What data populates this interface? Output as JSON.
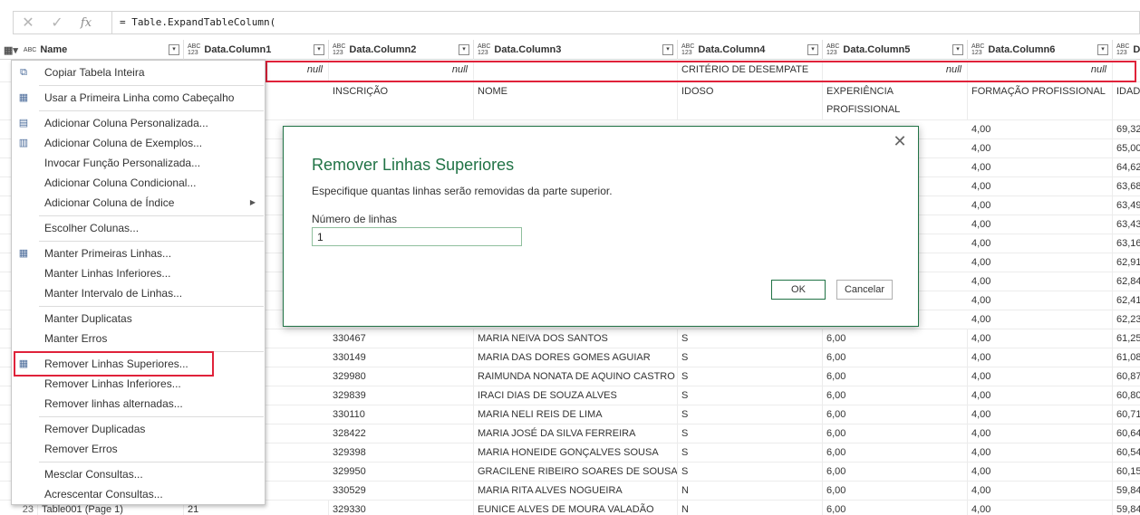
{
  "formula": {
    "cancel_icon": "✕",
    "confirm_icon": "✓",
    "fx_label": "fx",
    "text": "= Table.ExpandTableColumn("
  },
  "columns": [
    {
      "label": "Name",
      "type": "ABC"
    },
    {
      "label": "Data.Column1",
      "type_top": "ABC",
      "type_bottom": "123"
    },
    {
      "label": "Data.Column2",
      "type_top": "ABC",
      "type_bottom": "123"
    },
    {
      "label": "Data.Column3",
      "type_top": "ABC",
      "type_bottom": "123"
    },
    {
      "label": "Data.Column4",
      "type_top": "ABC",
      "type_bottom": "123"
    },
    {
      "label": "Data.Column5",
      "type_top": "ABC",
      "type_bottom": "123"
    },
    {
      "label": "Data.Column6",
      "type_top": "ABC",
      "type_bottom": "123"
    },
    {
      "label": "D",
      "type_top": "ABC",
      "type_bottom": "123"
    }
  ],
  "first_row": {
    "c1": "null",
    "c2": "null",
    "c3": "",
    "c4": "CRITÉRIO DE DESEMPATE",
    "c5": "null",
    "c6": "null"
  },
  "second_row": {
    "c2": "INSCRIÇÃO",
    "c3": "NOME",
    "c4": "IDOSO",
    "c5": "EXPERIÊNCIA PROFISSIONAL",
    "c6": "FORMAÇÃO PROFISSIONAL",
    "c7": "IDADE"
  },
  "hidden_rows": [
    {
      "c6": "4,00",
      "c7": "69,32"
    },
    {
      "c6": "4,00",
      "c7": "65,00"
    },
    {
      "c6": "4,00",
      "c7": "64,62"
    },
    {
      "c6": "4,00",
      "c7": "63,68"
    },
    {
      "c6": "4,00",
      "c7": "63,49"
    },
    {
      "c6": "4,00",
      "c7": "63,43"
    },
    {
      "c6": "4,00",
      "c7": "63,16"
    },
    {
      "c6": "4,00",
      "c7": "62,91"
    },
    {
      "c6": "4,00",
      "c7": "62,84"
    },
    {
      "c6": "4,00",
      "c7": "62,41"
    },
    {
      "c6": "4,00",
      "c7": "62,23"
    }
  ],
  "rows": [
    {
      "c2": "330467",
      "c3": "MARIA NEIVA DOS SANTOS",
      "c4": "S",
      "c5": "6,00",
      "c6": "4,00",
      "c7": "61,25"
    },
    {
      "c2": "330149",
      "c3": "MARIA DAS DORES GOMES AGUIAR",
      "c4": "S",
      "c5": "6,00",
      "c6": "4,00",
      "c7": "61,08"
    },
    {
      "c2": "329980",
      "c3": "RAIMUNDA NONATA DE AQUINO CASTRO",
      "c4": "S",
      "c5": "6,00",
      "c6": "4,00",
      "c7": "60,87"
    },
    {
      "c2": "329839",
      "c3": "IRACI DIAS DE SOUZA ALVES",
      "c4": "S",
      "c5": "6,00",
      "c6": "4,00",
      "c7": "60,80"
    },
    {
      "c2": "330110",
      "c3": "MARIA NELI REIS DE LIMA",
      "c4": "S",
      "c5": "6,00",
      "c6": "4,00",
      "c7": "60,71"
    },
    {
      "c2": "328422",
      "c3": "MARIA JOSÉ DA SILVA FERREIRA",
      "c4": "S",
      "c5": "6,00",
      "c6": "4,00",
      "c7": "60,64"
    },
    {
      "c2": "329398",
      "c3": "MARIA HONEIDE GONÇALVES SOUSA",
      "c4": "S",
      "c5": "6,00",
      "c6": "4,00",
      "c7": "60,54"
    },
    {
      "c2": "329950",
      "c3": "GRACILENE RIBEIRO SOARES DE SOUSA",
      "c4": "S",
      "c5": "6,00",
      "c6": "4,00",
      "c7": "60,15"
    },
    {
      "c2": "330529",
      "c3": "MARIA RITA ALVES NOGUEIRA",
      "c4": "N",
      "c5": "6,00",
      "c6": "4,00",
      "c7": "59,84"
    },
    {
      "rn": "23",
      "c0": "Table001 (Page 1)",
      "c1": "21",
      "c2": "329330",
      "c3": "EUNICE ALVES DE MOURA VALADÃO",
      "c4": "N",
      "c5": "6,00",
      "c6": "4,00",
      "c7": "59,84"
    }
  ],
  "menu": {
    "items": [
      {
        "label": "Copiar Tabela Inteira",
        "icon": "copy-table-icon"
      },
      {
        "label": "Usar a Primeira Linha como Cabeçalho",
        "icon": "header-table-icon"
      },
      {
        "label": "Adicionar Coluna Personalizada...",
        "icon": "custom-column-icon"
      },
      {
        "label": "Adicionar Coluna de Exemplos...",
        "icon": "example-column-icon"
      },
      {
        "label": "Invocar Função Personalizada...",
        "icon": ""
      },
      {
        "label": "Adicionar Coluna Condicional...",
        "icon": ""
      },
      {
        "label": "Adicionar Coluna de Índice",
        "icon": "",
        "submenu": true
      },
      {
        "label": "Escolher Colunas...",
        "icon": ""
      },
      {
        "label": "Manter Primeiras Linhas...",
        "icon": "keep-rows-icon"
      },
      {
        "label": "Manter Linhas Inferiores...",
        "icon": ""
      },
      {
        "label": "Manter Intervalo de Linhas...",
        "icon": ""
      },
      {
        "label": "Manter Duplicatas",
        "icon": ""
      },
      {
        "label": "Manter Erros",
        "icon": ""
      },
      {
        "label": "Remover Linhas Superiores...",
        "icon": "remove-rows-icon"
      },
      {
        "label": "Remover Linhas Inferiores...",
        "icon": ""
      },
      {
        "label": "Remover linhas alternadas...",
        "icon": ""
      },
      {
        "label": "Remover Duplicadas",
        "icon": ""
      },
      {
        "label": "Remover Erros",
        "icon": ""
      },
      {
        "label": "Mesclar Consultas...",
        "icon": ""
      },
      {
        "label": "Acrescentar Consultas...",
        "icon": ""
      }
    ]
  },
  "dialog": {
    "title": "Remover Linhas Superiores",
    "description": "Especifique quantas linhas serão removidas da parte superior.",
    "field_label": "Número de linhas",
    "field_value": "1",
    "ok_label": "OK",
    "cancel_label": "Cancelar",
    "close_glyph": "✕"
  },
  "colors": {
    "accent": "#217346",
    "highlight": "#e0223a"
  }
}
